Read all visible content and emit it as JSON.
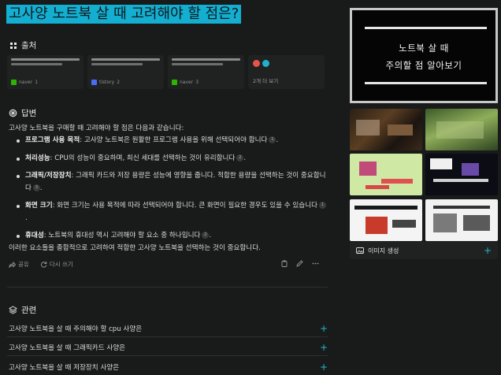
{
  "question": "고사양 노트북 살 때 고려해야 할 점은?",
  "sources": {
    "heading": "출처",
    "cards": [
      {
        "site": "naver",
        "num": "1",
        "fav_color": "#2db400"
      },
      {
        "site": "tistory",
        "num": "2",
        "fav_color": "#4a6cf7"
      },
      {
        "site": "naver",
        "num": "3",
        "fav_color": "#2db400"
      }
    ],
    "more_label": "2개 더 보기",
    "more_dots": [
      "#e8534a",
      "#1fb3c9"
    ]
  },
  "answer": {
    "heading": "답변",
    "intro": "고사양 노트북을 구매할 때 고려해야 할 점은 다음과 같습니다:",
    "items": [
      {
        "title": "프로그램 사용 목적",
        "text": ": 고사양 노트북은 원활한 프로그램 사용을 위해 선택되어야 합니다",
        "cite": "1",
        "tail": "."
      },
      {
        "title": "처리성능",
        "text": ": CPU의 성능이 중요하며, 최신 세대를 선택하는 것이 유리합니다",
        "cite": "2",
        "tail": "."
      },
      {
        "title": "그래픽/저장장치",
        "text": ": 그래픽 카드와 저장 용량은 성능에 영향을 줍니다. 적합한 용량을 선택하는 것이 중요합니다",
        "cite": "3",
        "tail": "."
      },
      {
        "title": "화면 크기",
        "text": ": 화면 크기는 사용 목적에 따라 선택되어야 합니다. 큰 화면이 필요한 경우도 있을 수 있습니다",
        "cite": "1",
        "tail": "."
      },
      {
        "title": "휴대성",
        "text": ": 노트북의 휴대성 역시 고려해야 할 요소 중 하나입니다",
        "cite": "2",
        "tail": "."
      }
    ],
    "outro": "이러한 요소들을 종합적으로 고려하여 적합한 고사양 노트북을 선택하는 것이 중요합니다."
  },
  "actions": {
    "share": "공유",
    "rewrite": "다시 쓰기"
  },
  "related": {
    "heading": "관련",
    "items": [
      "고사양 노트북을 살 때 주의해야 할 cpu 사양은",
      "고사양 노트북을 살 때 그래픽카드 사양은",
      "고사양 노트북을 살 때 저장장치 사양은"
    ]
  },
  "images": {
    "main_line1": "노트북 살 때",
    "main_line2": "주의할 점 알아보기",
    "generate_label": "이미지 생성"
  },
  "colors": {
    "accent": "#20b8cd",
    "title_bg": "#13aed0",
    "background": "#191a1a",
    "card": "#202222"
  }
}
